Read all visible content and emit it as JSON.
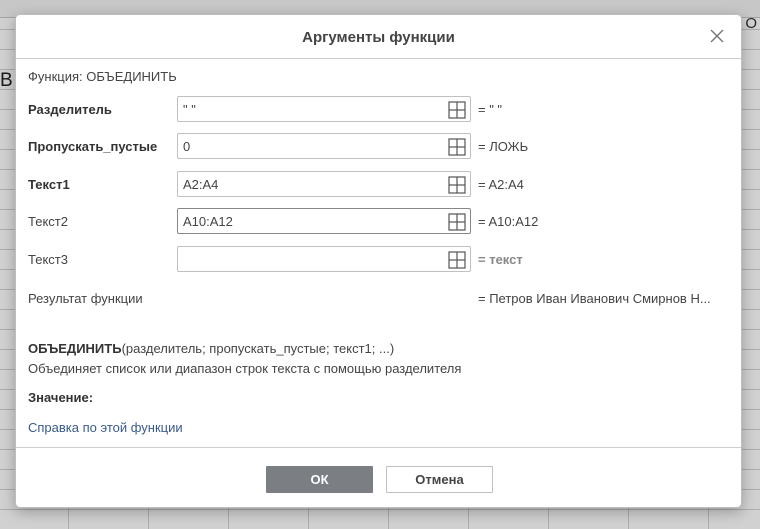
{
  "spreadsheet": {
    "column_header_o": "O",
    "cell_text": "В"
  },
  "dialog": {
    "title": "Аргументы функции",
    "function_line": "Функция: ОБЪЕДИНИТЬ",
    "arguments": [
      {
        "label": "Разделитель",
        "bold": true,
        "value": "\" \"",
        "evaluated": "= \" \""
      },
      {
        "label": "Пропускать_пустые",
        "bold": true,
        "value": "0",
        "evaluated": "= ЛОЖЬ"
      },
      {
        "label": "Текст1",
        "bold": true,
        "value": "A2:A4",
        "evaluated": "= A2:A4"
      },
      {
        "label": "Текст2",
        "bold": false,
        "value": "A10:A12",
        "evaluated": "= A10:A12"
      },
      {
        "label": "Текст3",
        "bold": false,
        "value": "",
        "evaluated": "= текст"
      }
    ],
    "result_label": "Результат функции",
    "result_value": "= Петров Иван Иванович Смирнов Н...",
    "syntax_name": "ОБЪЕДИНИТЬ",
    "syntax_args": "(разделитель; пропускать_пустые; текст1; ...)",
    "description": "Объединяет список или диапазон строк текста с помощью разделителя",
    "value_label": "Значение:",
    "help_link": "Справка по этой функции",
    "ok_label": "ОК",
    "cancel_label": "Отмена"
  },
  "colors": {
    "ok_button": "#7b7f83",
    "link": "#3a5a8c",
    "border": "#c0c0c0"
  },
  "icons": {
    "close": "close-icon",
    "range_select": "range-select-icon"
  }
}
